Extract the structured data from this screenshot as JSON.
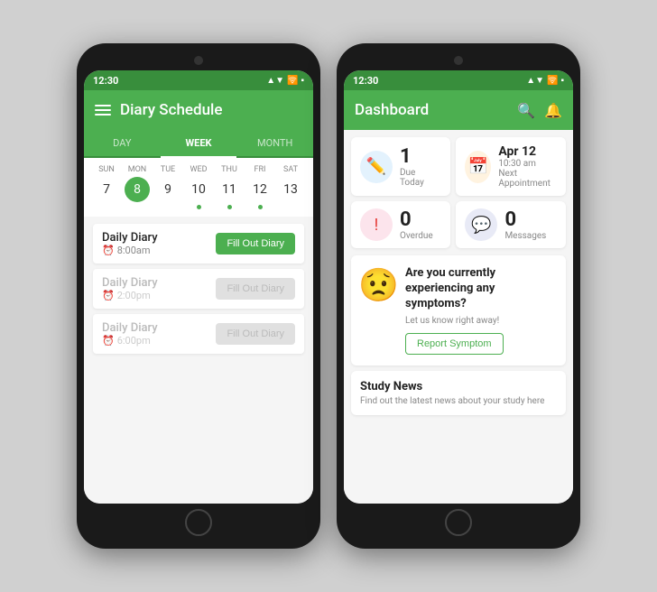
{
  "background": "#d0d0d0",
  "phone1": {
    "status_bar": {
      "time": "12:30",
      "signal": "▲▼",
      "wifi": "WiFi",
      "battery": "🔋"
    },
    "header": {
      "title": "Diary Schedule",
      "menu_icon": "menu"
    },
    "tabs": [
      {
        "label": "DAY",
        "active": false
      },
      {
        "label": "WEEK",
        "active": true
      },
      {
        "label": "MONTH",
        "active": false
      }
    ],
    "calendar": {
      "days": [
        {
          "name": "Sun",
          "num": "7",
          "active": false,
          "dot": false
        },
        {
          "name": "Mon",
          "num": "8",
          "active": true,
          "dot": true
        },
        {
          "name": "Tue",
          "num": "9",
          "active": false,
          "dot": false
        },
        {
          "name": "Wed",
          "num": "10",
          "active": false,
          "dot": true
        },
        {
          "name": "Thu",
          "num": "11",
          "active": false,
          "dot": true
        },
        {
          "name": "Fri",
          "num": "12",
          "active": false,
          "dot": true
        },
        {
          "name": "Sat",
          "num": "13",
          "active": false,
          "dot": false
        }
      ]
    },
    "diary_items": [
      {
        "title": "Daily Diary",
        "time": "8:00am",
        "active": true,
        "button_label": "Fill Out Diary"
      },
      {
        "title": "Daily Diary",
        "time": "2:00pm",
        "active": false,
        "button_label": "Fill Out Diary"
      },
      {
        "title": "Daily Diary",
        "time": "6:00pm",
        "active": false,
        "button_label": "Fill Out Diary"
      }
    ]
  },
  "phone2": {
    "status_bar": {
      "time": "12:30"
    },
    "header": {
      "title": "Dashboard",
      "search_icon": "search",
      "bell_icon": "bell"
    },
    "cards": [
      {
        "icon": "✏️",
        "icon_bg": "#e3f2fd",
        "number": "1",
        "label": "Due Today"
      },
      {
        "icon": "📅",
        "icon_bg": "#fff3e0",
        "date": "Apr 12",
        "sub": "10:30 am",
        "label": "Next Appointment"
      },
      {
        "icon": "❗",
        "icon_bg": "#fce4ec",
        "number": "0",
        "label": "Overdue"
      },
      {
        "icon": "💬",
        "icon_bg": "#e8eaf6",
        "number": "0",
        "label": "Messages"
      }
    ],
    "symptom": {
      "emoji": "😟",
      "title": "Are you currently experiencing any symptoms?",
      "sub": "Let us know right away!",
      "button_label": "Report Symptom"
    },
    "study_news": {
      "title": "Study News",
      "sub": "Find out the latest news about your study here"
    }
  }
}
